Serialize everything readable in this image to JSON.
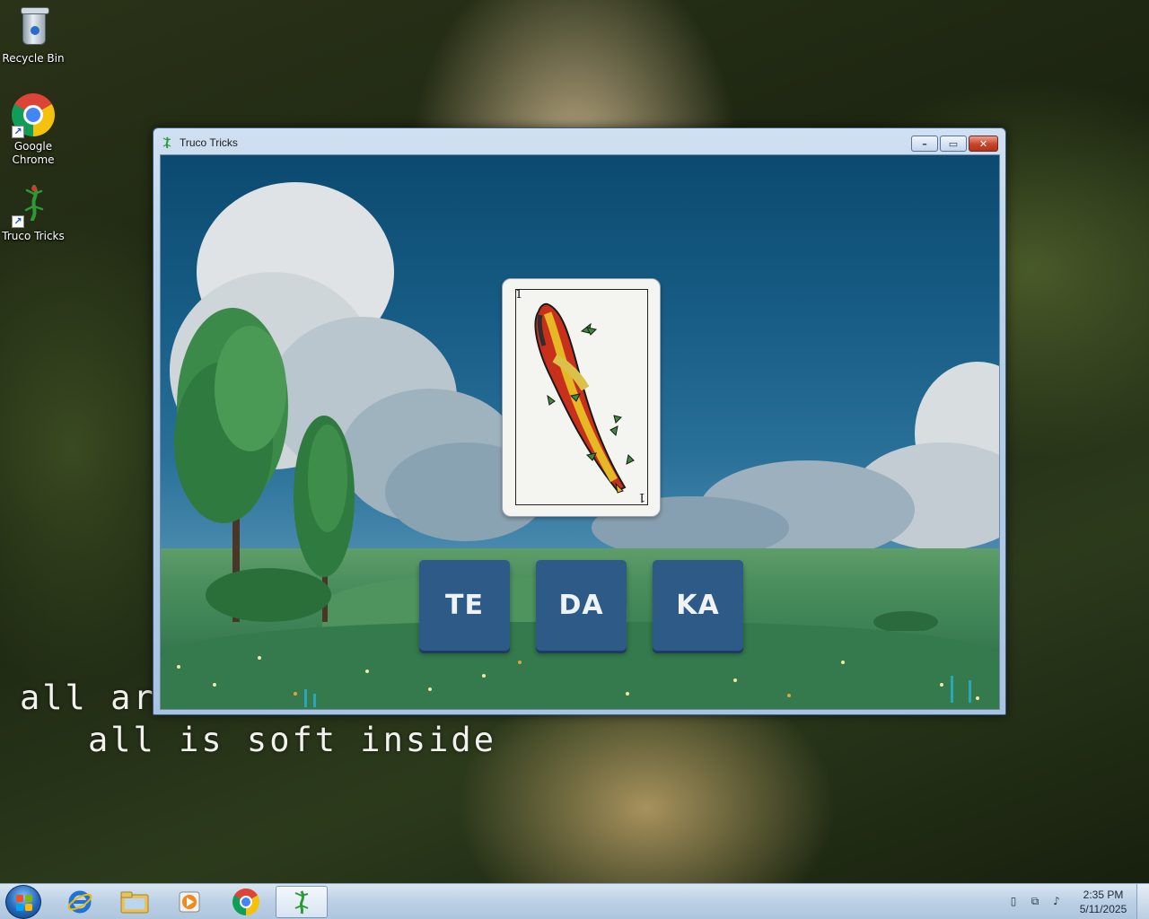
{
  "desktop": {
    "icons": [
      {
        "label": "Recycle Bin"
      },
      {
        "label": "Google\nChrome"
      },
      {
        "label": "Truco Tricks"
      }
    ],
    "lyrics": [
      "all arc",
      "all is soft inside"
    ]
  },
  "window": {
    "title": "Truco Tricks",
    "buttons": {
      "minimize": "–",
      "maximize": "▭",
      "close": "✕"
    }
  },
  "game": {
    "card": {
      "rank": "1",
      "suit": "bastos"
    },
    "syllables": [
      "TE",
      "DA",
      "KA"
    ]
  },
  "taskbar": {
    "apps": [
      "Start",
      "Internet Explorer",
      "Windows Explorer",
      "Windows Media Player",
      "Google Chrome",
      "Truco Tricks"
    ],
    "clock": {
      "time": "2:35 PM",
      "date": "5/11/2025"
    }
  }
}
